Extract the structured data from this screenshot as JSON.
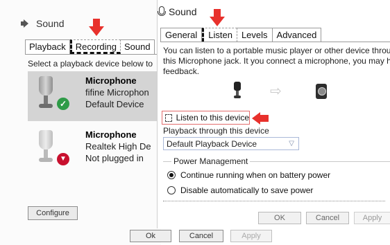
{
  "background_dialog": {
    "title": "Sound",
    "tabs": [
      "Playback",
      "Recording",
      "Sound"
    ],
    "selected_tab": "Recording",
    "hint": "Select a playback device below to",
    "devices": [
      {
        "name": "Microphone",
        "line2": "fifine Microphon",
        "line3": "Default Device",
        "status": "default",
        "selected": true
      },
      {
        "name": "Microphone",
        "line2": "Realtek High De",
        "line3": "Not plugged in",
        "status": "unplugged",
        "selected": false
      }
    ],
    "configure_label": "Configure",
    "ok_label": "Ok",
    "cancel_label": "Cancel",
    "apply_label": "Apply"
  },
  "properties_dialog": {
    "title": "Sound",
    "tabs": [
      "General",
      "Listen",
      "Levels",
      "Advanced"
    ],
    "selected_tab": "Listen",
    "description": [
      "You can listen to a portable music player or other device through",
      "this Microphone jack. It you connect a microphone, you may hear",
      "feedback."
    ],
    "listen_checkbox_label": "Listen to this device",
    "listen_checked": false,
    "playback_label": "Playback through this device",
    "playback_value": "Default Playback Device",
    "power_management": {
      "legend": "Power Management",
      "options": [
        "Continue running when on battery power",
        "Disable automatically to save power"
      ],
      "selected_index": 0
    },
    "ok_label": "OK",
    "cancel_label": "Cancel",
    "apply_label": "Apply"
  },
  "colors": {
    "annotation_red": "#e8312c",
    "default_badge": "#2e9b47",
    "unplugged_badge": "#c8102e",
    "selected_row": "#d4d4d4"
  },
  "icons": {
    "background_title": "speaker-icon",
    "properties_title": "microphone-icon",
    "default_status": "check-icon",
    "unplugged_status": "down-arrow-icon",
    "illustration": [
      "microphone-icon",
      "arrow-right-icon",
      "speaker-device-icon"
    ]
  }
}
